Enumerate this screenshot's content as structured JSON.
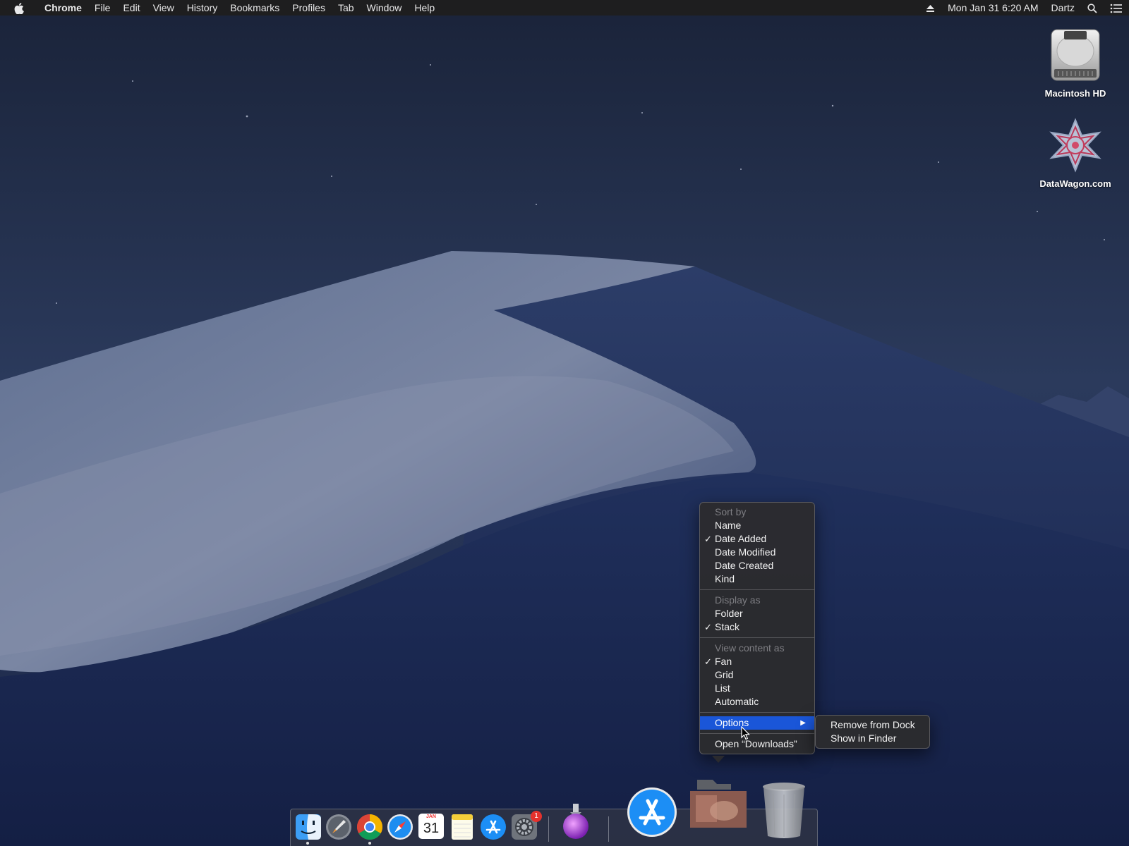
{
  "menubar": {
    "app_name": "Chrome",
    "menus": [
      "File",
      "Edit",
      "View",
      "History",
      "Bookmarks",
      "Profiles",
      "Tab",
      "Window",
      "Help"
    ],
    "datetime": "Mon Jan 31  6:20 AM",
    "user": "Dartz"
  },
  "desktop": {
    "icons": [
      {
        "label": "Macintosh HD"
      },
      {
        "label": "DataWagon.com"
      }
    ]
  },
  "context_menu": {
    "sort_header": "Sort by",
    "sort_items": [
      {
        "label": "Name",
        "checked": false
      },
      {
        "label": "Date Added",
        "checked": true
      },
      {
        "label": "Date Modified",
        "checked": false
      },
      {
        "label": "Date Created",
        "checked": false
      },
      {
        "label": "Kind",
        "checked": false
      }
    ],
    "display_header": "Display as",
    "display_items": [
      {
        "label": "Folder",
        "checked": false
      },
      {
        "label": "Stack",
        "checked": true
      }
    ],
    "view_header": "View content as",
    "view_items": [
      {
        "label": "Fan",
        "checked": true
      },
      {
        "label": "Grid",
        "checked": false
      },
      {
        "label": "List",
        "checked": false
      },
      {
        "label": "Automatic",
        "checked": false
      }
    ],
    "options_label": "Options",
    "open_label": "Open “Downloads”",
    "check_glyph": "✓",
    "arrow_glyph": "▶"
  },
  "options_submenu": {
    "items": [
      "Remove from Dock",
      "Show in Finder"
    ]
  },
  "dock": {
    "apps": [
      "finder-icon",
      "launchpad-icon",
      "chrome-icon",
      "safari-icon",
      "calendar-icon",
      "notes-icon",
      "app-store-icon",
      "system-preferences-icon",
      "potion-app-icon",
      "app-store-large-icon",
      "downloads-stack-icon",
      "trash-icon"
    ],
    "calendar_month": "JAN",
    "calendar_day": "31",
    "system_prefs_badge": "1"
  },
  "colors": {
    "menu_highlight": "#1a56d8",
    "menu_bg": "#2b2b2e",
    "menubar_bg": "#1e1e1f"
  }
}
